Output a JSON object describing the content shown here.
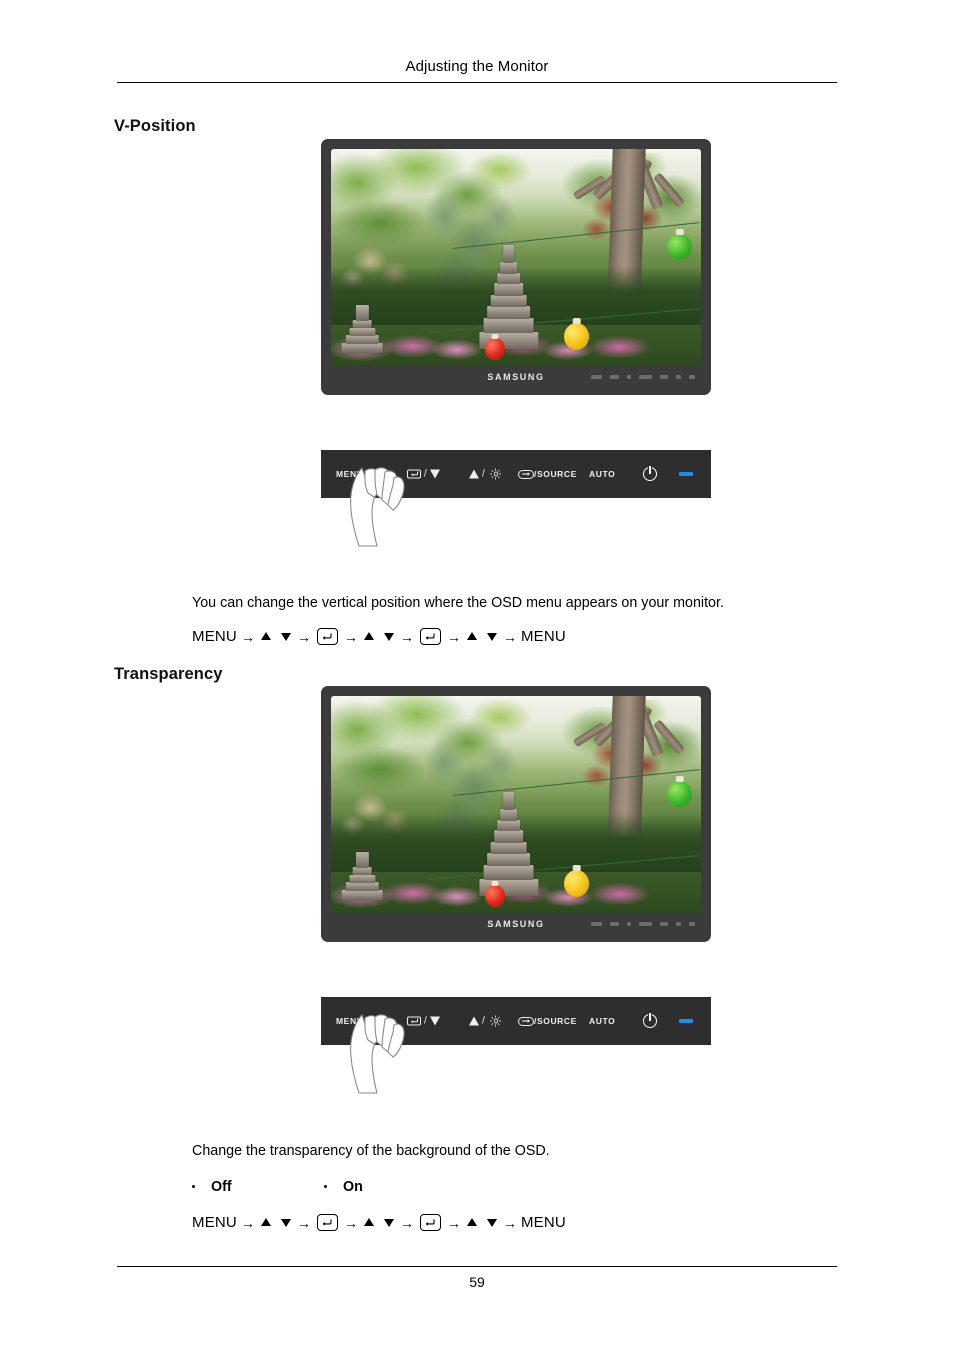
{
  "header": {
    "title": "Adjusting the Monitor"
  },
  "footer": {
    "page_number": "59"
  },
  "sections": [
    {
      "id": "v-position",
      "heading": "V-Position",
      "description": "You can change the vertical position where the OSD menu appears on your monitor.",
      "nav_path": {
        "start_label": "MENU",
        "end_label": "MENU",
        "arrow": "→"
      }
    },
    {
      "id": "transparency",
      "heading": "Transparency",
      "description": "Change the transparency of the background of the OSD.",
      "options": [
        {
          "label": "Off"
        },
        {
          "label": "On"
        }
      ],
      "nav_path": {
        "start_label": "MENU",
        "end_label": "MENU",
        "arrow": "→"
      }
    }
  ],
  "monitor": {
    "brand_logo": "SAMSUNG",
    "bezel_color": "#3b3b3b",
    "screen_alt": "Korean garden scene with stone pagodas, paper lanterns and trees"
  },
  "control_panel": {
    "background_color": "#2e2e2e",
    "led_color": "#1a8fe8",
    "buttons": [
      {
        "name": "menu",
        "label": "MENU",
        "icon": "osd-menu-icon"
      },
      {
        "name": "enter-down",
        "label": "",
        "icon": "enter-key-icon",
        "separator": "/",
        "icon2": "triangle-down-icon"
      },
      {
        "name": "up-brightness",
        "label": "",
        "icon": "triangle-up-icon",
        "separator": "/",
        "icon2": "brightness-icon"
      },
      {
        "name": "source",
        "label": "/SOURCE",
        "icon": "source-icon"
      },
      {
        "name": "auto",
        "label": "AUTO",
        "icon": ""
      },
      {
        "name": "power",
        "label": "",
        "icon": "power-icon"
      },
      {
        "name": "led",
        "label": "",
        "icon": "led-indicator-icon"
      }
    ]
  }
}
